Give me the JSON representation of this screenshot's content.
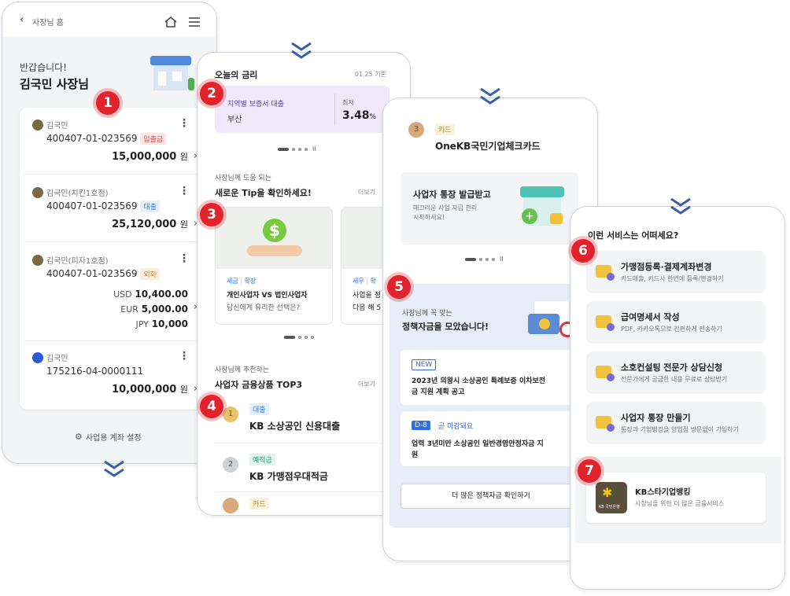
{
  "screen1": {
    "back_label": "사장님 홈",
    "greeting": "반갑습니다!",
    "owner_name": "김국민 사장님",
    "accounts": [
      {
        "bank": "김국민",
        "number": "400407-01-023569",
        "tag": "입출금",
        "amount": "15,000,000",
        "unit": "원"
      },
      {
        "bank": "김국민(치킨1호점)",
        "number": "400407-01-023569",
        "tag": "대출",
        "amount": "25,120,000",
        "unit": "원"
      },
      {
        "bank": "김국민(피자1호점)",
        "number": "400407-01-023569",
        "tag": "외화",
        "usd_label": "USD",
        "usd": "10,400.00",
        "eur_label": "EUR",
        "eur": "5,000.00",
        "jpy_label": "JPY",
        "jpy": "10,000"
      },
      {
        "bank": "김국민",
        "number": "175216-04-0000111",
        "amount": "10,000,000",
        "unit": "원"
      }
    ],
    "settings_label": "사업용 계좌 설정"
  },
  "screen2": {
    "rate_title": "오늘의 금리",
    "rate_time": "01.25 기준",
    "rate_card": {
      "name": "지역별 보증서 대출",
      "region": "부산",
      "min_label": "최저",
      "rate": "3.48",
      "rate_unit": "%"
    },
    "tips_sub": "사장님께 도움 되는",
    "tips_title": "새로운 Tip을 확인하세요!",
    "more": "더보기",
    "tip_cards": [
      {
        "tag1": "세금",
        "tag2": "확장",
        "title": "개인사업자 VS 법인사업자",
        "desc": "당신에게 유리한 선택은?"
      },
      {
        "tag1": "세무",
        "tag2": "확",
        "title": "사업을 정",
        "desc": "다음 해 5"
      }
    ],
    "products_sub": "사장님께 추천하는",
    "products_title": "사업자 금융상품 TOP3",
    "products": [
      {
        "tag": "대출",
        "name": "KB 소상공인 신용대출",
        "rank": "1"
      },
      {
        "tag": "예적금",
        "name": "KB 가맹점우대적금",
        "rank": "2"
      },
      {
        "tag": "카드",
        "name": "",
        "rank": "3"
      }
    ]
  },
  "screen3": {
    "card_tag": "카드",
    "card_name": "OneKB국민기업체크카드",
    "card_rank": "3",
    "promo_title": "사업자 통장 발급받고",
    "promo_desc1": "매끄러운 사업 자금 관리",
    "promo_desc2": "시작하세요!",
    "fund_sub": "사장님께 꼭 맞는",
    "fund_title": "정책자금을 모았습니다!",
    "items": [
      {
        "badge": "NEW",
        "text1": "2023년 의왕시 소상공인 특례보증 이차보전",
        "text2": "금 지원 계획 공고"
      },
      {
        "badge": "D-8",
        "badge_note": "곧 마감돼요",
        "text1": "업력 3년미만 소상공인 일반경영안정자금 지",
        "text2": "원"
      }
    ],
    "more_button": "더 많은 정책자금 확인하기"
  },
  "screen4": {
    "title": "이런 서비스는 어떠세요?",
    "services": [
      {
        "title": "가맹점등록·결제계좌변경",
        "desc": "카드매출, 카드사 한번에 등록/변경하기"
      },
      {
        "title": "급여명세서 작성",
        "desc": "PDF, 카카오톡으로 간편하게 전송하기"
      },
      {
        "title": "소호컨설팅 전문가 상담신청",
        "desc": "전문가에게 궁금한 내용 무료로 상담받기"
      },
      {
        "title": "사업자 통장 만들기",
        "desc": "통장과 기업뱅킹을 영업점 방문없이 가입하기"
      }
    ],
    "star_title": "KB스타기업뱅킹",
    "star_desc": "사장님을 위한 더 많은 금융서비스",
    "star_logo_text": "KB 국민은행"
  },
  "badges": [
    "1",
    "2",
    "3",
    "4",
    "5",
    "6",
    "7"
  ],
  "colors": {
    "badge_red": "#e2232c",
    "chevron": "#3a5fa8",
    "rate_bg": "#efe9fb",
    "fund_bg": "#e8eef9",
    "accent_blue": "#2f6fe0"
  }
}
